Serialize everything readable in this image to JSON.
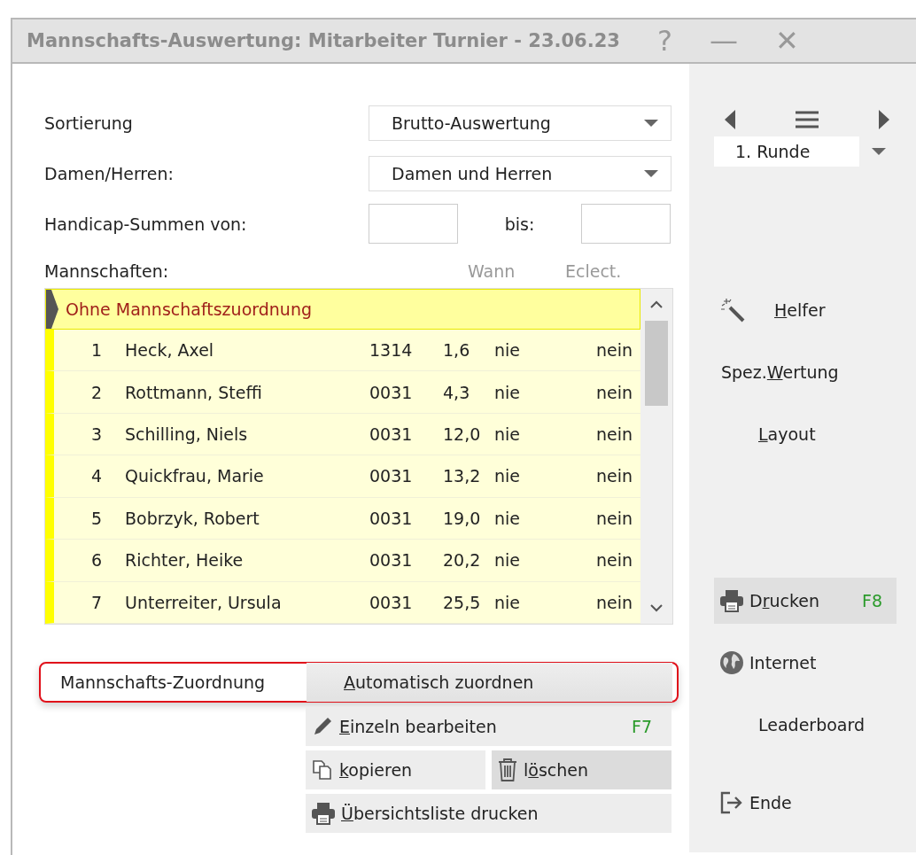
{
  "window": {
    "title": "Mannschafts-Auswertung: Mitarbeiter Turnier - 23.06.23",
    "controls": [
      "?",
      "—",
      "✕"
    ]
  },
  "form": {
    "fields": [
      {
        "kind": "dropdown",
        "label": "Sortierung",
        "value": "Brutto-Auswertung"
      },
      {
        "kind": "dropdown",
        "label": "Damen/Herren:",
        "value": "Damen und Herren"
      },
      {
        "kind": "range",
        "label": "Handicap-Summen von:",
        "to_label": "bis:"
      }
    ]
  },
  "teams": {
    "label": "Mannschaften:",
    "columns": [
      "Wann",
      "Eclect."
    ],
    "group": {
      "title": "Ohne Mannschaftszuordnung",
      "selected": true
    },
    "rows": [
      {
        "number": "1",
        "name": "Heck, Axel",
        "club": "1314",
        "handicap": "1,6",
        "wann": "nie",
        "eclect": "nein"
      },
      {
        "number": "2",
        "name": "Rottmann, Steffi",
        "club": "0031",
        "handicap": "4,3",
        "wann": "nie",
        "eclect": "nein"
      },
      {
        "number": "3",
        "name": "Schilling, Niels",
        "club": "0031",
        "handicap": "12,0",
        "wann": "nie",
        "eclect": "nein"
      },
      {
        "number": "4",
        "name": "Quickfrau, Marie",
        "club": "0031",
        "handicap": "13,2",
        "wann": "nie",
        "eclect": "nein"
      },
      {
        "number": "5",
        "name": "Bobrzyk, Robert",
        "club": "0031",
        "handicap": "19,0",
        "wann": "nie",
        "eclect": "nein"
      },
      {
        "number": "6",
        "name": "Richter, Heike",
        "club": "0031",
        "handicap": "20,2",
        "wann": "nie",
        "eclect": "nein"
      },
      {
        "number": "7",
        "name": "Unterreiter, Ursula",
        "club": "0031",
        "handicap": "25,5",
        "wann": "nie",
        "eclect": "nein"
      }
    ]
  },
  "assignment": {
    "label": "Mannschafts-Zuordnung",
    "highlighted": true,
    "buttons": [
      {
        "kind": "wide",
        "label": {
          "key": "A",
          "after": "utomatisch zuordnen"
        },
        "pressed": false
      },
      {
        "kind": "wide",
        "label": {
          "key": "E",
          "after": "inzeln bearbeiten"
        },
        "shortcut": "F7",
        "pressed": false
      },
      {
        "kind": "half",
        "label": {
          "key": "k",
          "after": "opieren"
        },
        "pressed": false
      },
      {
        "kind": "half",
        "label": {
          "before": "l",
          "key": "ö",
          "after": "schen"
        },
        "pressed": true
      },
      {
        "kind": "wide",
        "label": {
          "key": "Ü",
          "after": "bersichtsliste drucken"
        },
        "pressed": false
      }
    ]
  },
  "sidebar": {
    "round": "1. Runde",
    "items": [
      {
        "label": {
          "key": "H",
          "after": "elfer"
        },
        "selected": false
      },
      {
        "label": {
          "before": "Spez.",
          "key": "W",
          "after": "ertung"
        },
        "selected": false
      },
      {
        "label": {
          "key": "L",
          "after": "ayout"
        },
        "selected": false
      },
      {
        "label": {
          "before": "D",
          "key": "r",
          "after": "ucken"
        },
        "shortcut": "F8",
        "selected": true
      },
      {
        "label": {
          "before": "Internet"
        },
        "selected": false
      },
      {
        "label": {
          "before": "Leaderboard"
        },
        "selected": false
      },
      {
        "label": {
          "before": "Ende"
        },
        "selected": false
      }
    ]
  }
}
